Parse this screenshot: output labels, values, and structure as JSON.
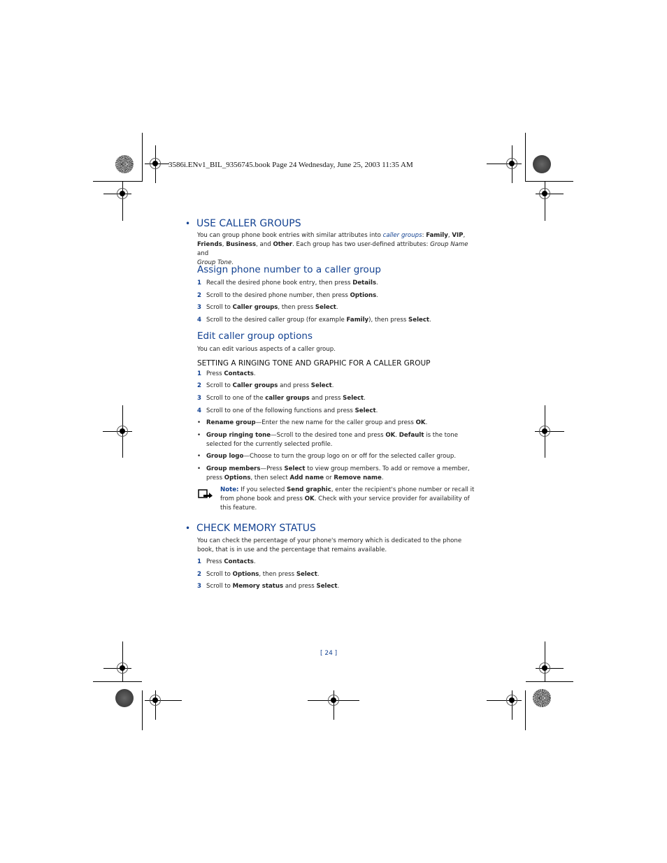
{
  "header": {
    "print_line": "3586i.ENv1_BIL_9356745.book  Page 24  Wednesday, June 25, 2003  11:35 AM"
  },
  "sections": {
    "use_caller_groups": {
      "bullet": "•",
      "title": "USE CALLER GROUPS",
      "intro": {
        "t1": "You can group phone book entries with similar attributes into ",
        "link": "caller groups",
        "t2": ": ",
        "b1": "Family",
        "t3": ", ",
        "b2": "VIP",
        "t4": ",",
        "b3": "Friends",
        "t5": ", ",
        "b4": "Business",
        "t6": ", and ",
        "b5": "Other",
        "t7": ". Each group has two user-defined attributes: ",
        "i1": "Group Name",
        "t8": " and",
        "i2": "Group Tone",
        "t9": "."
      }
    },
    "assign": {
      "title": "Assign phone number to a caller group",
      "steps": [
        {
          "num": "1",
          "a": "Recall the desired phone book entry, then press ",
          "b": "Details",
          "c": "."
        },
        {
          "num": "2",
          "a": "Scroll to the desired phone number, then press ",
          "b": "Options",
          "c": "."
        },
        {
          "num": "3",
          "a": "Scroll to ",
          "b": "Caller groups",
          "c": ", then press ",
          "d": "Select",
          "e": "."
        },
        {
          "num": "4",
          "a": "Scroll to the desired caller group (for example ",
          "b": "Family",
          "c": "), then press ",
          "d": "Select",
          "e": "."
        }
      ]
    },
    "edit": {
      "title": "Edit caller group options",
      "intro": "You can edit various aspects of a caller group.",
      "subtitle": "SETTING A RINGING TONE AND GRAPHIC FOR A CALLER GROUP",
      "steps": [
        {
          "num": "1",
          "a": "Press ",
          "b": "Contacts",
          "c": "."
        },
        {
          "num": "2",
          "a": "Scroll to ",
          "b": "Caller groups",
          "c": " and press ",
          "d": "Select",
          "e": "."
        },
        {
          "num": "3",
          "a": "Scroll to one of the ",
          "b": "caller groups",
          "c": " and press ",
          "d": "Select",
          "e": "."
        },
        {
          "num": "4",
          "a": "Scroll to one of the following functions and press ",
          "b": "Select",
          "c": "."
        }
      ],
      "bullets": [
        {
          "b": "Rename group",
          "a": "—Enter the new name for the caller group and press ",
          "c": "OK",
          "d": "."
        },
        {
          "b": "Group ringing tone",
          "a": "—Scroll to the desired tone and press ",
          "c": "OK",
          "d": ". ",
          "e": "Default",
          "f": " is the tone selected for the currently selected profile."
        },
        {
          "b": "Group logo",
          "a": "—Choose to turn the group logo on or off for the selected caller group."
        },
        {
          "b": "Group members",
          "a": "—Press ",
          "c": "Select",
          "d": " to view group members. To add or remove a member, press ",
          "e": "Options",
          "f": ", then select ",
          "g": "Add name",
          "h": " or ",
          "i": "Remove name",
          "j": "."
        }
      ],
      "note": {
        "label": "Note:",
        "a": " If you selected ",
        "b": "Send graphic",
        "c": ", enter the recipient's phone number or recall it from phone book and press ",
        "d": "OK",
        "e": ". Check with your service provider for availability of this feature."
      }
    },
    "memory": {
      "bullet": "•",
      "title": "CHECK MEMORY STATUS",
      "intro": "You can check the percentage of your phone's memory which is dedicated to the phone book, that is in use and the percentage that remains available.",
      "steps": [
        {
          "num": "1",
          "a": "Press ",
          "b": "Contacts",
          "c": "."
        },
        {
          "num": "2",
          "a": "Scroll to ",
          "b": "Options",
          "c": ", then press ",
          "d": "Select",
          "e": "."
        },
        {
          "num": "3",
          "a": "Scroll to ",
          "b": "Memory status",
          "c": " and press ",
          "d": "Select",
          "e": "."
        }
      ]
    }
  },
  "footer": {
    "page_number": "[ 24 ]"
  },
  "colors": {
    "heading_blue": "#124191"
  },
  "icons": {
    "note": "note-hand-icon",
    "registration": "registration-target-icon",
    "color_wheel": "color-wheel-icon"
  }
}
